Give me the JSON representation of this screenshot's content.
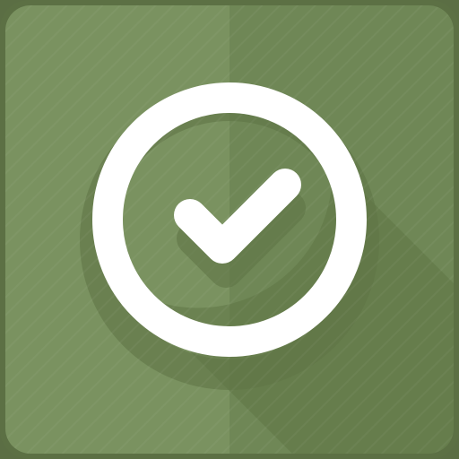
{
  "icon": {
    "name": "check-circle-icon",
    "colors": {
      "tile_left": "#7a9260",
      "tile_right": "#6f8756",
      "tile_border": "#5c7044",
      "shadow": "#5f7446",
      "glyph": "#ffffff"
    }
  }
}
